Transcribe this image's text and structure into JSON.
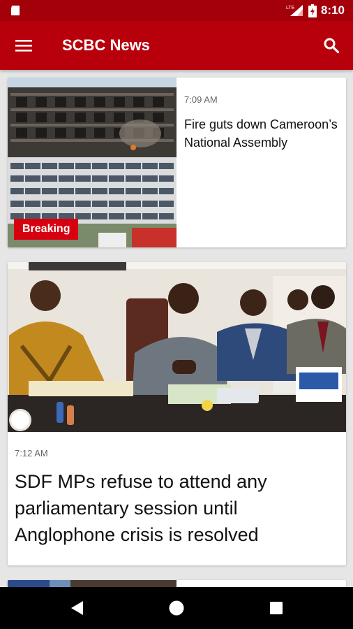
{
  "status_bar": {
    "time": "8:10",
    "network_label": "LTE",
    "icons": [
      "notification-icon",
      "lte-signal-icon",
      "battery-icon"
    ]
  },
  "app_bar": {
    "title": "SCBC News",
    "icons": [
      "menu-icon",
      "search-icon"
    ],
    "color": "#b8000c"
  },
  "articles": [
    {
      "time": "7:09 AM",
      "headline": "Fire guts down Cameroon’s National Assembly",
      "badge": "Breaking",
      "image": "burned-building-photo"
    },
    {
      "time": "7:12 AM",
      "headline": "SDF MPs refuse to attend any parliamentary session until Anglophone crisis is resolved",
      "image": "officials-at-desk-photo"
    }
  ],
  "nav_bar": {
    "icons": [
      "back-icon",
      "home-icon",
      "recents-icon"
    ]
  }
}
